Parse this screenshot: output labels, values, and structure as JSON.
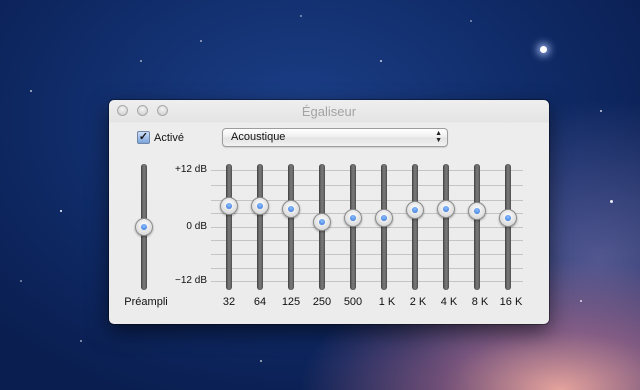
{
  "window": {
    "title": "Égaliseur",
    "controls": [
      "close-button",
      "minimize-button",
      "zoom-button"
    ]
  },
  "enabled_checkbox": {
    "label": "Activé",
    "checked": true
  },
  "preset_popup": {
    "value": "Acoustique"
  },
  "scale_labels": {
    "top": "+12 dB",
    "middle": "0 dB",
    "bottom": "−12 dB"
  },
  "preamp": {
    "label": "Préampli",
    "gain_db": 0
  },
  "bands": [
    {
      "label": "32",
      "gain_db": 4.5
    },
    {
      "label": "64",
      "gain_db": 4.5
    },
    {
      "label": "125",
      "gain_db": 3.8
    },
    {
      "label": "250",
      "gain_db": 1.0
    },
    {
      "label": "500",
      "gain_db": 2.0
    },
    {
      "label": "1 K",
      "gain_db": 1.8
    },
    {
      "label": "2 K",
      "gain_db": 3.5
    },
    {
      "label": "4 K",
      "gain_db": 3.7
    },
    {
      "label": "8 K",
      "gain_db": 3.3
    },
    {
      "label": "16 K",
      "gain_db": 2.0
    }
  ],
  "range_db": [
    -12,
    12
  ],
  "colors": {
    "knob_center": "#2f6fd6",
    "track": "#5a5a5a"
  }
}
